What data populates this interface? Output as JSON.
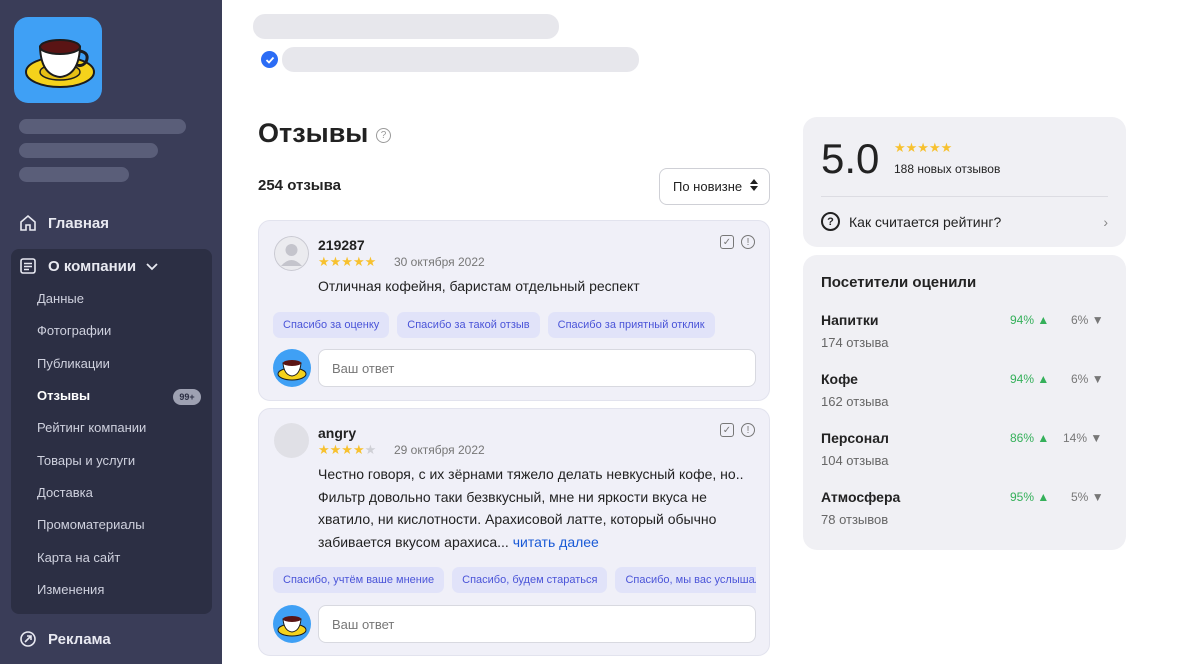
{
  "sidebar": {
    "nav": [
      {
        "label": "Главная",
        "icon": "home-icon"
      },
      {
        "label": "О компании",
        "icon": "document-icon"
      },
      {
        "label": "Реклама",
        "icon": "ad-icon"
      }
    ],
    "submenu": [
      "Данные",
      "Фотографии",
      "Публикации",
      "Отзывы",
      "Рейтинг компании",
      "Товары и услуги",
      "Доставка",
      "Промоматериалы",
      "Карта на сайт",
      "Изменения"
    ],
    "reviews_badge": "99+"
  },
  "main": {
    "title": "Отзывы",
    "count": "254 отзыва",
    "sort_label": "По новизне"
  },
  "reviews": [
    {
      "author": "219287",
      "rating": 5,
      "date": "30 октября 2022",
      "text": "Отличная кофейня, баристам отдельный респект",
      "read_more": "",
      "chips": [
        "Спасибо за оценку",
        "Спасибо за такой отзыв",
        "Спасибо за приятный отклик"
      ],
      "reply_placeholder": "Ваш ответ"
    },
    {
      "author": "angry",
      "rating": 4,
      "date": "29 октября 2022",
      "text": "Честно говоря, с их зёрнами тяжело делать невкусный кофе, но.. Фильтр довольно таки безвкусный, мне ни яркости вкуса не хватило, ни кислотности. Арахисовой латте, который обычно забивается вкусом арахиса... ",
      "read_more": "читать далее",
      "chips": [
        "Спасибо, учтём ваше мнение",
        "Спасибо, будем стараться",
        "Спасибо, мы вас услышали"
      ],
      "reply_placeholder": "Ваш ответ"
    }
  ],
  "rating_panel": {
    "score": "5.0",
    "stars": 5,
    "new_reviews": "188 новых отзывов",
    "how_label": "Как считается рейтинг?"
  },
  "visitors_panel": {
    "title": "Посетители оценили",
    "aspects": [
      {
        "name": "Напитки",
        "count": "174 отзыва",
        "positive": "94%",
        "negative": "6%"
      },
      {
        "name": "Кофе",
        "count": "162 отзыва",
        "positive": "94%",
        "negative": "6%"
      },
      {
        "name": "Персонал",
        "count": "104 отзыва",
        "positive": "86%",
        "negative": "14%"
      },
      {
        "name": "Атмосфера",
        "count": "78 отзывов",
        "positive": "95%",
        "negative": "5%"
      }
    ]
  },
  "colors": {
    "sidebar": "#3a3d58",
    "accent_blue": "#1a5ad6",
    "positive": "#35b05a",
    "star": "#f7c12f"
  }
}
